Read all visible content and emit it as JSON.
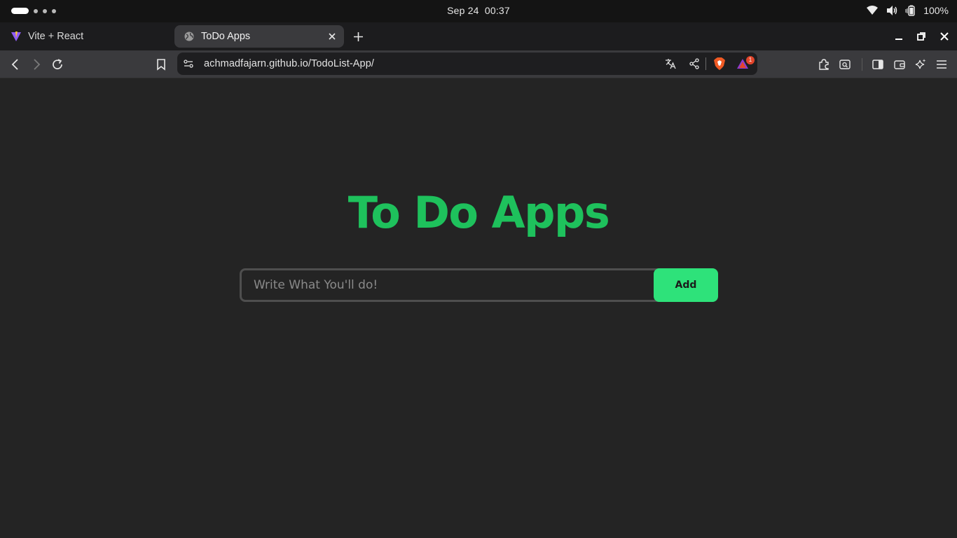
{
  "system": {
    "date": "Sep 24",
    "time": "00:37",
    "battery": "100%"
  },
  "tabs": [
    {
      "title": "Vite + React",
      "icon": "vite-icon",
      "active": false
    },
    {
      "title": "ToDo Apps",
      "icon": "globe-icon",
      "active": true
    }
  ],
  "toolbar": {
    "url": "achmadfajarn.github.io/TodoList-App/",
    "notification_count": "1"
  },
  "app": {
    "title": "To Do Apps",
    "input_placeholder": "Write What You'll do!",
    "input_value": "",
    "add_label": "Add"
  },
  "colors": {
    "title": "#1ec15c",
    "add_button": "#2ee27a",
    "background": "#242424"
  }
}
